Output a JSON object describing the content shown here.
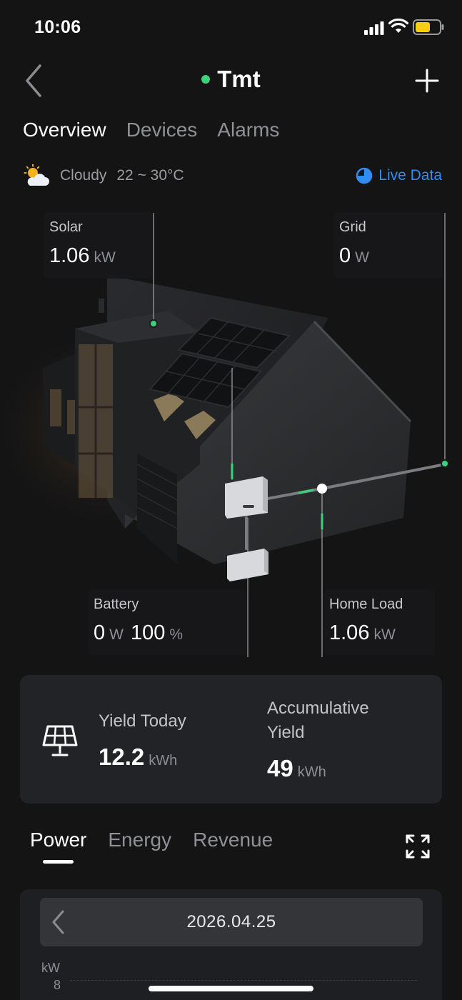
{
  "status_bar": {
    "time": "10:06"
  },
  "header": {
    "title": "Tmt",
    "status_color": "#3ad27b"
  },
  "tabs": [
    "Overview",
    "Devices",
    "Alarms"
  ],
  "weather": {
    "condition": "Cloudy",
    "range": "22 ~ 30°C"
  },
  "live_data": {
    "label": "Live Data",
    "color": "#2f8cf5"
  },
  "flows": {
    "solar": {
      "label": "Solar",
      "value": "1.06",
      "unit": "kW"
    },
    "grid": {
      "label": "Grid",
      "value": "0",
      "unit": "W"
    },
    "battery": {
      "label": "Battery",
      "power": "0",
      "power_unit": "W",
      "soc": "100",
      "soc_unit": "%"
    },
    "home_load": {
      "label": "Home Load",
      "value": "1.06",
      "unit": "kW"
    }
  },
  "yield": {
    "today": {
      "label": "Yield Today",
      "value": "12.2",
      "unit": "kWh"
    },
    "accumulative": {
      "label_line1": "Accumulative",
      "label_line2": "Yield",
      "value": "49",
      "unit": "kWh"
    }
  },
  "chart_tabs": [
    "Power",
    "Energy",
    "Revenue"
  ],
  "chart": {
    "date": "2026.04.25",
    "y_unit": "kW",
    "y_tick": "8"
  }
}
